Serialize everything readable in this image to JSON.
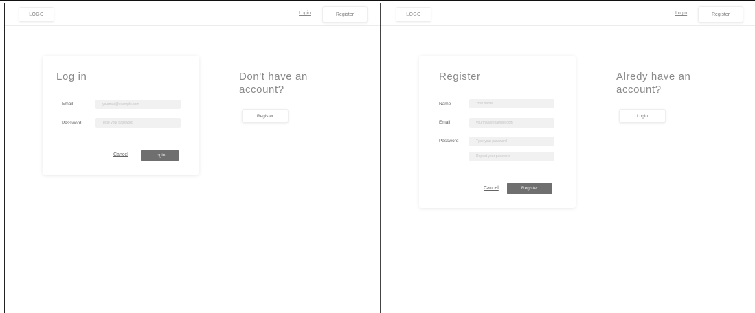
{
  "login_screen": {
    "header": {
      "logo": "LOGO",
      "login_link": "Login",
      "register_button": "Register"
    },
    "form": {
      "title": "Log in",
      "email_label": "Email",
      "email_placeholder": "yourmail@example.com",
      "password_label": "Password",
      "password_placeholder": "Type your password",
      "cancel_label": "Cancel",
      "submit_label": "Login"
    },
    "alternate": {
      "title_line1": "Don't have an",
      "title_line2": "account?",
      "button_label": "Register"
    }
  },
  "register_screen": {
    "header": {
      "logo": "LOGO",
      "login_link": "Login",
      "register_button": "Register"
    },
    "form": {
      "title": "Register",
      "name_label": "Name",
      "name_placeholder": "Your name",
      "email_label": "Email",
      "email_placeholder": "yourmail@example.com",
      "password_label": "Password",
      "password_placeholder": "Type your password",
      "repeat_password_placeholder": "Repeat your password",
      "cancel_label": "Cancel",
      "submit_label": "Register"
    },
    "alternate": {
      "title_line1": "Alredy have an",
      "title_line2": "account?",
      "button_label": "Login"
    }
  },
  "colors": {
    "primary_button": "#6f6f6f",
    "input_background": "#f1f1f1",
    "title_text": "#8a8a8a"
  }
}
